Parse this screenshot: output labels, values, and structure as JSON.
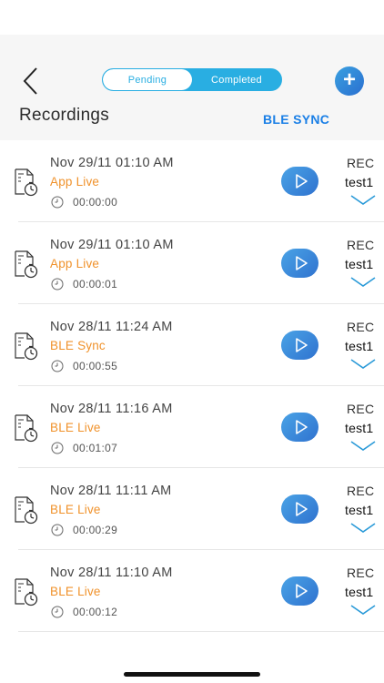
{
  "segments": {
    "pending_label": "Pending",
    "completed_label": "Completed"
  },
  "header": {
    "title": "Recordings",
    "ble_sync_label": "BLE SYNC",
    "add_label": "+"
  },
  "colors": {
    "accent": "#29aee2",
    "source": "#f0922b",
    "link": "#1a7fe6"
  },
  "icons": [
    "back-chevron-icon",
    "plus-icon",
    "file-timer-icon",
    "clock-icon",
    "play-icon",
    "chevron-down-icon"
  ],
  "recordings": [
    {
      "date": "Nov 29/11 01:10 AM",
      "source": "App Live",
      "duration": "00:00:00",
      "tag": "REC",
      "name": "test1"
    },
    {
      "date": "Nov 29/11 01:10 AM",
      "source": "App Live",
      "duration": "00:00:01",
      "tag": "REC",
      "name": "test1"
    },
    {
      "date": "Nov 28/11 11:24 AM",
      "source": "BLE Sync",
      "duration": "00:00:55",
      "tag": "REC",
      "name": "test1"
    },
    {
      "date": "Nov 28/11 11:16 AM",
      "source": "BLE Live",
      "duration": "00:01:07",
      "tag": "REC",
      "name": "test1"
    },
    {
      "date": "Nov 28/11 11:11 AM",
      "source": "BLE Live",
      "duration": "00:00:29",
      "tag": "REC",
      "name": "test1"
    },
    {
      "date": "Nov 28/11 11:10 AM",
      "source": "BLE Live",
      "duration": "00:00:12",
      "tag": "REC",
      "name": "test1"
    }
  ]
}
